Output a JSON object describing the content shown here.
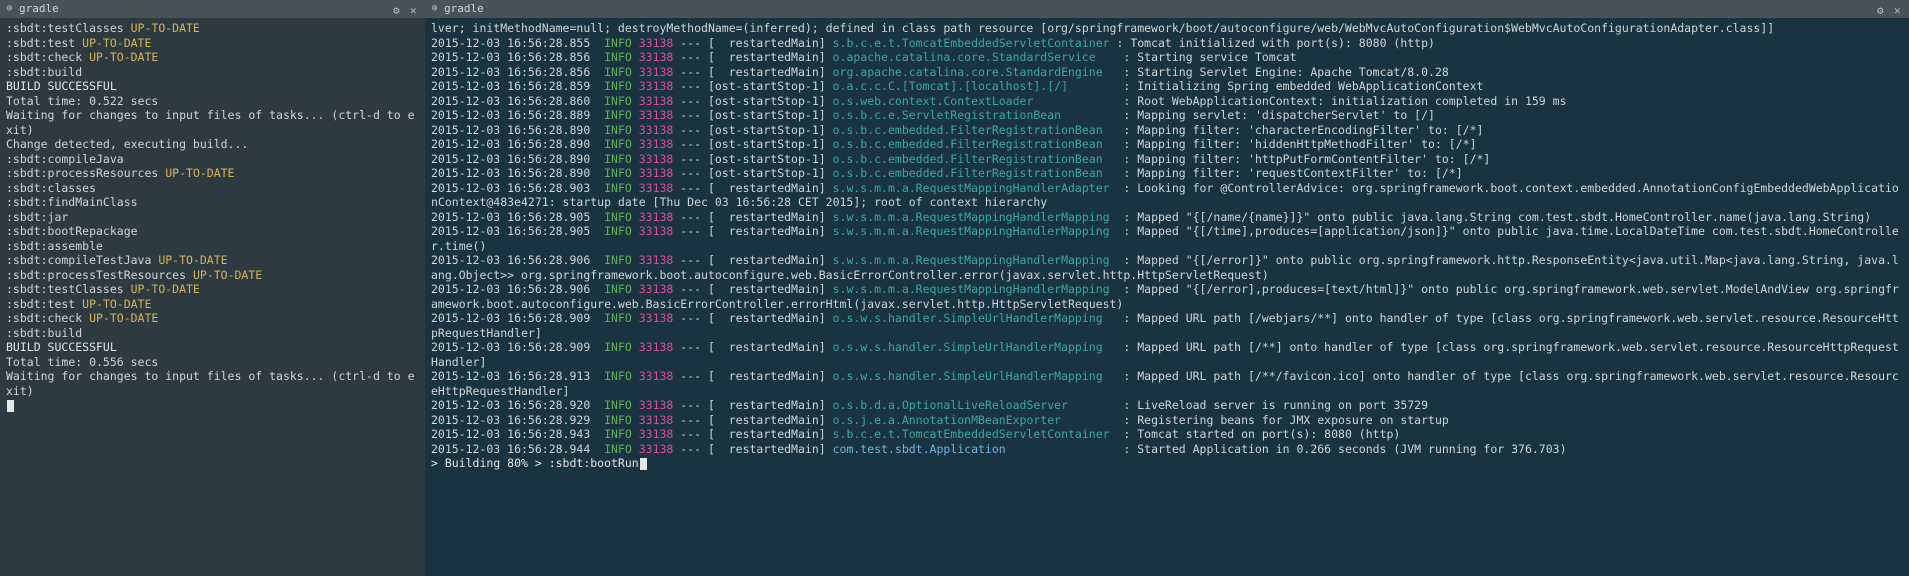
{
  "left": {
    "title": "gradle",
    "lines": [
      {
        "segments": [
          {
            "t": ":sbdt:testClasses ",
            "c": ""
          },
          {
            "t": "UP-TO-DATE",
            "c": "cy"
          }
        ]
      },
      {
        "segments": [
          {
            "t": ":sbdt:test ",
            "c": ""
          },
          {
            "t": "UP-TO-DATE",
            "c": "cy"
          }
        ]
      },
      {
        "segments": [
          {
            "t": ":sbdt:check ",
            "c": ""
          },
          {
            "t": "UP-TO-DATE",
            "c": "cy"
          }
        ]
      },
      {
        "segments": [
          {
            "t": ":sbdt:build",
            "c": ""
          }
        ]
      },
      {
        "segments": [
          {
            "t": "",
            "c": ""
          }
        ]
      },
      {
        "segments": [
          {
            "t": "BUILD SUCCESSFUL",
            "c": "cw"
          }
        ]
      },
      {
        "segments": [
          {
            "t": "",
            "c": ""
          }
        ]
      },
      {
        "segments": [
          {
            "t": "Total time: 0.522 secs",
            "c": ""
          }
        ]
      },
      {
        "segments": [
          {
            "t": "",
            "c": ""
          }
        ]
      },
      {
        "segments": [
          {
            "t": "Waiting for changes to input files of tasks... (ctrl-d to exit)",
            "c": ""
          }
        ]
      },
      {
        "segments": [
          {
            "t": "Change detected, executing build...",
            "c": ""
          }
        ]
      },
      {
        "segments": [
          {
            "t": "",
            "c": ""
          }
        ]
      },
      {
        "segments": [
          {
            "t": ":sbdt:compileJava",
            "c": ""
          }
        ]
      },
      {
        "segments": [
          {
            "t": ":sbdt:processResources ",
            "c": ""
          },
          {
            "t": "UP-TO-DATE",
            "c": "cy"
          }
        ]
      },
      {
        "segments": [
          {
            "t": ":sbdt:classes",
            "c": ""
          }
        ]
      },
      {
        "segments": [
          {
            "t": ":sbdt:findMainClass",
            "c": ""
          }
        ]
      },
      {
        "segments": [
          {
            "t": ":sbdt:jar",
            "c": ""
          }
        ]
      },
      {
        "segments": [
          {
            "t": ":sbdt:bootRepackage",
            "c": ""
          }
        ]
      },
      {
        "segments": [
          {
            "t": ":sbdt:assemble",
            "c": ""
          }
        ]
      },
      {
        "segments": [
          {
            "t": ":sbdt:compileTestJava ",
            "c": ""
          },
          {
            "t": "UP-TO-DATE",
            "c": "cy"
          }
        ]
      },
      {
        "segments": [
          {
            "t": ":sbdt:processTestResources ",
            "c": ""
          },
          {
            "t": "UP-TO-DATE",
            "c": "cy"
          }
        ]
      },
      {
        "segments": [
          {
            "t": ":sbdt:testClasses ",
            "c": ""
          },
          {
            "t": "UP-TO-DATE",
            "c": "cy"
          }
        ]
      },
      {
        "segments": [
          {
            "t": ":sbdt:test ",
            "c": ""
          },
          {
            "t": "UP-TO-DATE",
            "c": "cy"
          }
        ]
      },
      {
        "segments": [
          {
            "t": ":sbdt:check ",
            "c": ""
          },
          {
            "t": "UP-TO-DATE",
            "c": "cy"
          }
        ]
      },
      {
        "segments": [
          {
            "t": ":sbdt:build",
            "c": ""
          }
        ]
      },
      {
        "segments": [
          {
            "t": "",
            "c": ""
          }
        ]
      },
      {
        "segments": [
          {
            "t": "BUILD SUCCESSFUL",
            "c": "cw"
          }
        ]
      },
      {
        "segments": [
          {
            "t": "",
            "c": ""
          }
        ]
      },
      {
        "segments": [
          {
            "t": "Total time: 0.556 secs",
            "c": ""
          }
        ]
      },
      {
        "segments": [
          {
            "t": "",
            "c": ""
          }
        ]
      },
      {
        "segments": [
          {
            "t": "Waiting for changes to input files of tasks... (ctrl-d to exit)",
            "c": ""
          }
        ]
      },
      {
        "segments": [
          {
            "cursor": true
          }
        ]
      }
    ]
  },
  "right": {
    "title": "gradle",
    "first_line": "lver; initMethodName=null; destroyMethodName=(inferred); defined in class path resource [org/springframework/boot/autoconfigure/web/WebMvcAutoConfiguration$WebMvcAutoConfigurationAdapter.class]]",
    "lines": [
      {
        "ts": "2015-12-03 16:56:28.855",
        "lvl": "INFO",
        "pid": "33138",
        "sep": "--- [  restartedMain] ",
        "src": "s.b.c.e.t.TomcatEmbeddedServletContainer",
        "msg": ": Tomcat initialized with port(s): 8080 (http)"
      },
      {
        "ts": "2015-12-03 16:56:28.856",
        "lvl": "INFO",
        "pid": "33138",
        "sep": "--- [  restartedMain] ",
        "src": "o.apache.catalina.core.StandardService",
        "msg": "   : Starting service Tomcat"
      },
      {
        "ts": "2015-12-03 16:56:28.856",
        "lvl": "INFO",
        "pid": "33138",
        "sep": "--- [  restartedMain] ",
        "src": "org.apache.catalina.core.StandardEngine",
        "msg": "  : Starting Servlet Engine: Apache Tomcat/8.0.28"
      },
      {
        "ts": "2015-12-03 16:56:28.859",
        "lvl": "INFO",
        "pid": "33138",
        "sep": "--- [ost-startStop-1] ",
        "src": "o.a.c.c.C.[Tomcat].[localhost].[/]",
        "msg": "       : Initializing Spring embedded WebApplicationContext"
      },
      {
        "ts": "2015-12-03 16:56:28.860",
        "lvl": "INFO",
        "pid": "33138",
        "sep": "--- [ost-startStop-1] ",
        "src": "o.s.web.context.ContextLoader",
        "msg": "            : Root WebApplicationContext: initialization completed in 159 ms"
      },
      {
        "ts": "2015-12-03 16:56:28.889",
        "lvl": "INFO",
        "pid": "33138",
        "sep": "--- [ost-startStop-1] ",
        "src": "o.s.b.c.e.ServletRegistrationBean",
        "msg": "        : Mapping servlet: 'dispatcherServlet' to [/]"
      },
      {
        "ts": "2015-12-03 16:56:28.890",
        "lvl": "INFO",
        "pid": "33138",
        "sep": "--- [ost-startStop-1] ",
        "src": "o.s.b.c.embedded.FilterRegistrationBean",
        "msg": "  : Mapping filter: 'characterEncodingFilter' to: [/*]"
      },
      {
        "ts": "2015-12-03 16:56:28.890",
        "lvl": "INFO",
        "pid": "33138",
        "sep": "--- [ost-startStop-1] ",
        "src": "o.s.b.c.embedded.FilterRegistrationBean",
        "msg": "  : Mapping filter: 'hiddenHttpMethodFilter' to: [/*]"
      },
      {
        "ts": "2015-12-03 16:56:28.890",
        "lvl": "INFO",
        "pid": "33138",
        "sep": "--- [ost-startStop-1] ",
        "src": "o.s.b.c.embedded.FilterRegistrationBean",
        "msg": "  : Mapping filter: 'httpPutFormContentFilter' to: [/*]"
      },
      {
        "ts": "2015-12-03 16:56:28.890",
        "lvl": "INFO",
        "pid": "33138",
        "sep": "--- [ost-startStop-1] ",
        "src": "o.s.b.c.embedded.FilterRegistrationBean",
        "msg": "  : Mapping filter: 'requestContextFilter' to: [/*]"
      },
      {
        "ts": "2015-12-03 16:56:28.903",
        "lvl": "INFO",
        "pid": "33138",
        "sep": "--- [  restartedMain] ",
        "src": "s.w.s.m.m.a.RequestMappingHandlerAdapter",
        "msg": " : Looking for @ControllerAdvice: org.springframework.boot.context.embedded.AnnotationConfigEmbeddedWebApplicationContext@483e4271: startup date [Thu Dec 03 16:56:28 CET 2015]; root of context hierarchy"
      },
      {
        "ts": "2015-12-03 16:56:28.905",
        "lvl": "INFO",
        "pid": "33138",
        "sep": "--- [  restartedMain] ",
        "src": "s.w.s.m.m.a.RequestMappingHandlerMapping",
        "msg": " : Mapped \"{[/name/{name}]}\" onto public java.lang.String com.test.sbdt.HomeController.name(java.lang.String)"
      },
      {
        "ts": "2015-12-03 16:56:28.905",
        "lvl": "INFO",
        "pid": "33138",
        "sep": "--- [  restartedMain] ",
        "src": "s.w.s.m.m.a.RequestMappingHandlerMapping",
        "msg": " : Mapped \"{[/time],produces=[application/json]}\" onto public java.time.LocalDateTime com.test.sbdt.HomeController.time()"
      },
      {
        "ts": "2015-12-03 16:56:28.906",
        "lvl": "INFO",
        "pid": "33138",
        "sep": "--- [  restartedMain] ",
        "src": "s.w.s.m.m.a.RequestMappingHandlerMapping",
        "msg": " : Mapped \"{[/error]}\" onto public org.springframework.http.ResponseEntity<java.util.Map<java.lang.String, java.lang.Object>> org.springframework.boot.autoconfigure.web.BasicErrorController.error(javax.servlet.http.HttpServletRequest)"
      },
      {
        "ts": "2015-12-03 16:56:28.906",
        "lvl": "INFO",
        "pid": "33138",
        "sep": "--- [  restartedMain] ",
        "src": "s.w.s.m.m.a.RequestMappingHandlerMapping",
        "msg": " : Mapped \"{[/error],produces=[text/html]}\" onto public org.springframework.web.servlet.ModelAndView org.springframework.boot.autoconfigure.web.BasicErrorController.errorHtml(javax.servlet.http.HttpServletRequest)"
      },
      {
        "ts": "2015-12-03 16:56:28.909",
        "lvl": "INFO",
        "pid": "33138",
        "sep": "--- [  restartedMain] ",
        "src": "o.s.w.s.handler.SimpleUrlHandlerMapping",
        "msg": "  : Mapped URL path [/webjars/**] onto handler of type [class org.springframework.web.servlet.resource.ResourceHttpRequestHandler]"
      },
      {
        "ts": "2015-12-03 16:56:28.909",
        "lvl": "INFO",
        "pid": "33138",
        "sep": "--- [  restartedMain] ",
        "src": "o.s.w.s.handler.SimpleUrlHandlerMapping",
        "msg": "  : Mapped URL path [/**] onto handler of type [class org.springframework.web.servlet.resource.ResourceHttpRequestHandler]"
      },
      {
        "ts": "2015-12-03 16:56:28.913",
        "lvl": "INFO",
        "pid": "33138",
        "sep": "--- [  restartedMain] ",
        "src": "o.s.w.s.handler.SimpleUrlHandlerMapping",
        "msg": "  : Mapped URL path [/**/favicon.ico] onto handler of type [class org.springframework.web.servlet.resource.ResourceHttpRequestHandler]"
      },
      {
        "ts": "2015-12-03 16:56:28.920",
        "lvl": "INFO",
        "pid": "33138",
        "sep": "--- [  restartedMain] ",
        "src": "o.s.b.d.a.OptionalLiveReloadServer",
        "msg": "       : LiveReload server is running on port 35729"
      },
      {
        "ts": "2015-12-03 16:56:28.929",
        "lvl": "INFO",
        "pid": "33138",
        "sep": "--- [  restartedMain] ",
        "src": "o.s.j.e.a.AnnotationMBeanExporter",
        "msg": "        : Registering beans for JMX exposure on startup"
      },
      {
        "ts": "2015-12-03 16:56:28.943",
        "lvl": "INFO",
        "pid": "33138",
        "sep": "--- [  restartedMain] ",
        "src": "s.b.c.e.t.TomcatEmbeddedServletContainer",
        "msg": " : Tomcat started on port(s): 8080 (http)"
      },
      {
        "ts": "2015-12-03 16:56:28.944",
        "lvl": "INFO",
        "pid": "33138",
        "sep": "--- [  restartedMain] ",
        "src": "com.test.sbdt.Application",
        "msg": "                : Started Application in 0.266 seconds (JVM running for 376.703)",
        "src_class": "cb"
      }
    ],
    "last_line": "> Building 80% > :sbdt:bootRun"
  }
}
